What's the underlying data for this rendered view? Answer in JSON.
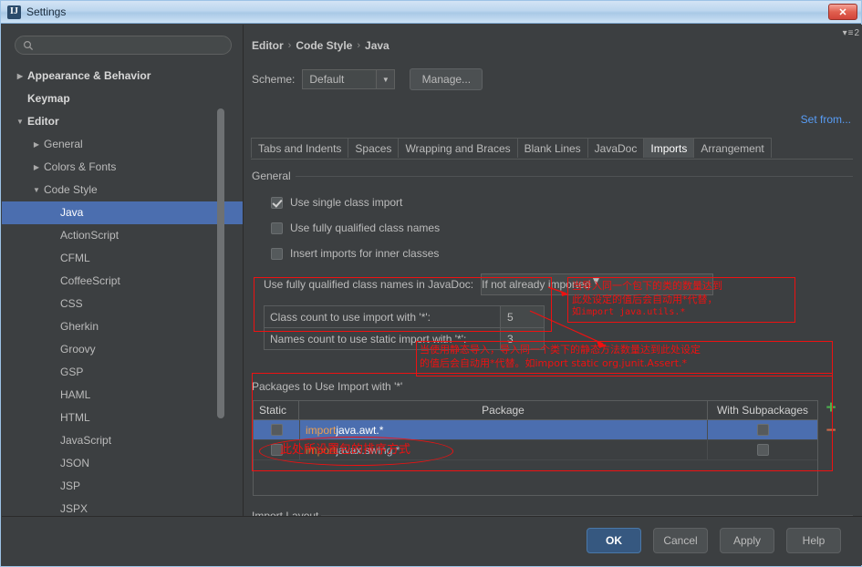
{
  "window": {
    "title": "Settings",
    "app_icon": "IJ",
    "close_label": "✕"
  },
  "sidebar": {
    "search_placeholder": "",
    "search_value": "",
    "items": [
      {
        "label": "Appearance & Behavior",
        "indent": 0,
        "twisty": "▶",
        "bold": true,
        "selected": false
      },
      {
        "label": "Keymap",
        "indent": 0,
        "twisty": "",
        "bold": true,
        "selected": false
      },
      {
        "label": "Editor",
        "indent": 0,
        "twisty": "▼",
        "bold": true,
        "selected": false
      },
      {
        "label": "General",
        "indent": 1,
        "twisty": "▶",
        "bold": false,
        "selected": false
      },
      {
        "label": "Colors & Fonts",
        "indent": 1,
        "twisty": "▶",
        "bold": false,
        "selected": false
      },
      {
        "label": "Code Style",
        "indent": 1,
        "twisty": "▼",
        "bold": false,
        "selected": false
      },
      {
        "label": "Java",
        "indent": 2,
        "twisty": "",
        "bold": false,
        "selected": true
      },
      {
        "label": "ActionScript",
        "indent": 2,
        "twisty": "",
        "bold": false,
        "selected": false
      },
      {
        "label": "CFML",
        "indent": 2,
        "twisty": "",
        "bold": false,
        "selected": false
      },
      {
        "label": "CoffeeScript",
        "indent": 2,
        "twisty": "",
        "bold": false,
        "selected": false
      },
      {
        "label": "CSS",
        "indent": 2,
        "twisty": "",
        "bold": false,
        "selected": false
      },
      {
        "label": "Gherkin",
        "indent": 2,
        "twisty": "",
        "bold": false,
        "selected": false
      },
      {
        "label": "Groovy",
        "indent": 2,
        "twisty": "",
        "bold": false,
        "selected": false
      },
      {
        "label": "GSP",
        "indent": 2,
        "twisty": "",
        "bold": false,
        "selected": false
      },
      {
        "label": "HAML",
        "indent": 2,
        "twisty": "",
        "bold": false,
        "selected": false
      },
      {
        "label": "HTML",
        "indent": 2,
        "twisty": "",
        "bold": false,
        "selected": false
      },
      {
        "label": "JavaScript",
        "indent": 2,
        "twisty": "",
        "bold": false,
        "selected": false
      },
      {
        "label": "JSON",
        "indent": 2,
        "twisty": "",
        "bold": false,
        "selected": false
      },
      {
        "label": "JSP",
        "indent": 2,
        "twisty": "",
        "bold": false,
        "selected": false
      },
      {
        "label": "JSPX",
        "indent": 2,
        "twisty": "",
        "bold": false,
        "selected": false
      }
    ]
  },
  "breadcrumb": {
    "part1": "Editor",
    "sep1": "›",
    "part2": "Code Style",
    "sep2": "›",
    "part3": "Java"
  },
  "scheme": {
    "label": "Scheme:",
    "value": "Default",
    "arrow": "▼",
    "manage_label": "Manage...",
    "set_from_label": "Set from..."
  },
  "tabs": {
    "items": [
      {
        "label": "Tabs and Indents",
        "active": false
      },
      {
        "label": "Spaces",
        "active": false
      },
      {
        "label": "Wrapping and Braces",
        "active": false
      },
      {
        "label": "Blank Lines",
        "active": false
      },
      {
        "label": "JavaDoc",
        "active": false
      },
      {
        "label": "Imports",
        "active": true
      },
      {
        "label": "Arrangement",
        "active": false
      }
    ],
    "overflow_label": "2",
    "overflow_icon": "≡"
  },
  "general": {
    "title": "General",
    "checkboxes": [
      {
        "label": "Use single class import",
        "checked": true
      },
      {
        "label": "Use fully qualified class names",
        "checked": false
      },
      {
        "label": "Insert imports for inner classes",
        "checked": false
      }
    ],
    "javadoc_label": "Use fully qualified class names in JavaDoc:",
    "javadoc_value": "If not already imported",
    "javadoc_arrow": "▼"
  },
  "counts": {
    "class_count_label": "Class count to use import with '*':",
    "class_count_value": "5",
    "static_count_label": "Names count to use static import with '*':",
    "static_count_value": "3"
  },
  "packages": {
    "section_label": "Packages to Use Import with '*'",
    "columns": [
      "Static",
      "Package",
      "With Subpackages"
    ],
    "rows": [
      {
        "static": false,
        "keyword": "import",
        "package": " java.awt.*",
        "subpackages": false,
        "selected": true
      },
      {
        "static": false,
        "keyword": "import",
        "package": " javax.swing.*",
        "subpackages": false,
        "selected": false
      }
    ],
    "add_label": "+",
    "remove_label": "−"
  },
  "import_layout": {
    "label": "Import Layout"
  },
  "buttons": {
    "ok": "OK",
    "cancel": "Cancel",
    "apply": "Apply",
    "help": "Help"
  },
  "annotations": {
    "class_count_note_line1": "当导入同一个包下的类的数量达到",
    "class_count_note_line2": "此处设定的值后会自动用*代替，",
    "class_count_note_line3": "如import java.utils.*",
    "static_note_line1": "当使用静态导入，导入同一个类下的静态方法数量达到此处设定",
    "static_note_line2": "的值后会自动用*代替。如import static org.junit.Assert.*",
    "table_note": "此处所设置包的排序方式"
  },
  "colors": {
    "accent_blue": "#4b6eaf",
    "annotation_red": "#ee1111",
    "link_blue": "#589df6",
    "keyword_orange": "#cc7832",
    "add_green": "#4caf50"
  }
}
